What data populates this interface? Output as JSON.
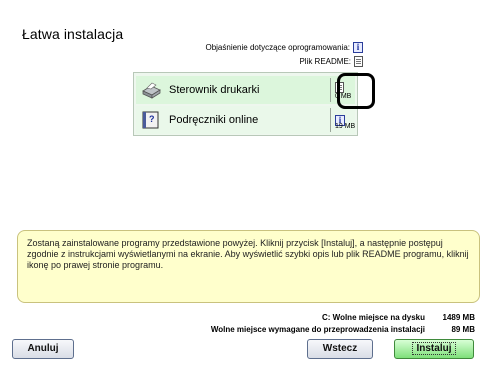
{
  "title": "Łatwa instalacja",
  "legend": {
    "info_label": "Objaśnienie dotyczące oprogramowania:",
    "info_icon": "info-icon",
    "readme_label": "Plik README:",
    "readme_icon": "readme-file-icon"
  },
  "items": [
    {
      "label": "Sterownik drukarki",
      "icon": "printer-icon",
      "detail_icon": "readme-file-icon",
      "size": "0 MB",
      "highlight_color": "#000000"
    },
    {
      "label": "Podręczniki online",
      "icon": "manual-book-icon",
      "detail_icon": "info-icon",
      "size": "19 MB"
    }
  ],
  "description": "Zostaną zainstalowane programy przedstawione powyżej. Kliknij przycisk [Instaluj], a następnie postępuj zgodnie z instrukcjami wyświetlanymi na ekranie. Aby wyświetlić szybki opis lub plik README programu, kliknij ikonę po prawej stronie programu.",
  "disk": {
    "free_label": "C: Wolne miejsce na dysku",
    "free_value": "1489 MB",
    "required_label": "Wolne miejsce wymagane do przeprowadzenia instalacji",
    "required_value": "89 MB"
  },
  "buttons": {
    "cancel": "Anuluj",
    "back": "Wstecz",
    "install": "Instaluj"
  },
  "colors": {
    "list_bg": "#dcf6dc",
    "description_bg": "#ffffcc",
    "install_button": "#7fe07a"
  }
}
